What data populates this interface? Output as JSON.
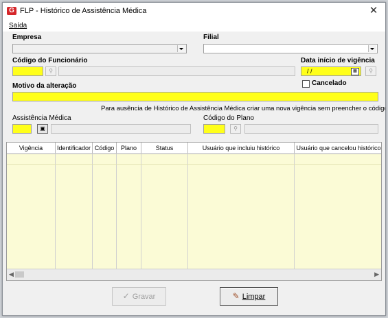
{
  "window": {
    "title": "FLP - Histórico de Assistência Médica",
    "close": "✕",
    "app_icon": "G"
  },
  "menu": {
    "exit_label": "Saída"
  },
  "form": {
    "empresa_label": "Empresa",
    "filial_label": "Filial",
    "codigo_funcionario_label": "Código do Funcionário",
    "data_inicio_label": "Data início de vigência",
    "data_inicio_value": "/ /",
    "cancelado_label": "Cancelado",
    "motivo_label": "Motivo da alteração",
    "hint_text": "Para ausência de Histórico de Assistência Médica criar uma nova vigência sem preencher o código",
    "assistencia_label": "Assistência Médica",
    "codigo_plano_label": "Código do Plano"
  },
  "grid": {
    "columns": [
      "Vigência",
      "Identificador",
      "Código",
      "Plano",
      "Status",
      "Usuário que incluiu histórico",
      "Usuário que cancelou histórico"
    ]
  },
  "buttons": {
    "gravar": "Gravar",
    "limpar": "Limpar"
  },
  "colors": {
    "required_field": "#ffff1a",
    "grid_bg": "#fbfbd6",
    "brand": "#d5262a"
  },
  "icons": [
    "app-logo-icon",
    "close-icon",
    "dropdown-arrow-icon",
    "binoculars-icon",
    "calendar-icon",
    "search-grid-icon",
    "checkmark-icon",
    "eraser-icon"
  ]
}
